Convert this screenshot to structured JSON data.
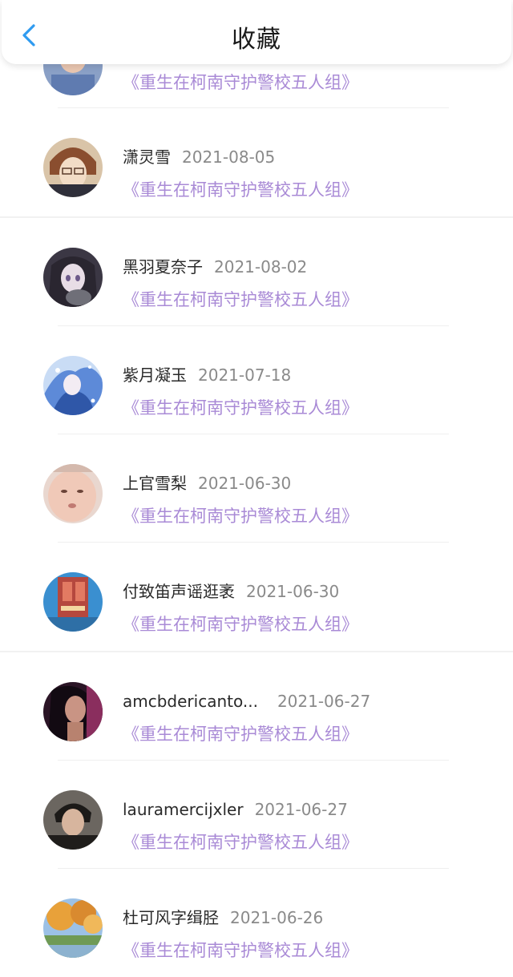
{
  "header": {
    "title": "收藏",
    "back_icon": "chevron-left-icon",
    "accent_color": "#2f9bf0"
  },
  "book_title": "《重生在柯南守护警校五人组》",
  "items": [
    {
      "name": "",
      "date": "",
      "book": "《重生在柯南守护警校五人组》"
    },
    {
      "name": "潇灵雪",
      "date": "2021-08-05",
      "book": "《重生在柯南守护警校五人组》"
    },
    {
      "name": "黑羽夏奈子",
      "date": "2021-08-02",
      "book": "《重生在柯南守护警校五人组》"
    },
    {
      "name": "紫月凝玉",
      "date": "2021-07-18",
      "book": "《重生在柯南守护警校五人组》"
    },
    {
      "name": "上官雪梨",
      "date": "2021-06-30",
      "book": "《重生在柯南守护警校五人组》"
    },
    {
      "name": "付致笛声谣逛袤",
      "date": "2021-06-30",
      "book": "《重生在柯南守护警校五人组》"
    },
    {
      "name": "amcbdericanto...",
      "date": "2021-06-27",
      "book": "《重生在柯南守护警校五人组》"
    },
    {
      "name": "lauramercijxler",
      "date": "2021-06-27",
      "book": "《重生在柯南守护警校五人组》"
    },
    {
      "name": "杜可风字缉胫",
      "date": "2021-06-26",
      "book": "《重生在柯南守护警校五人组》"
    }
  ],
  "colors": {
    "name": "#2a2a2a",
    "date": "#8a8a8a",
    "book_link": "#a98ad6"
  }
}
